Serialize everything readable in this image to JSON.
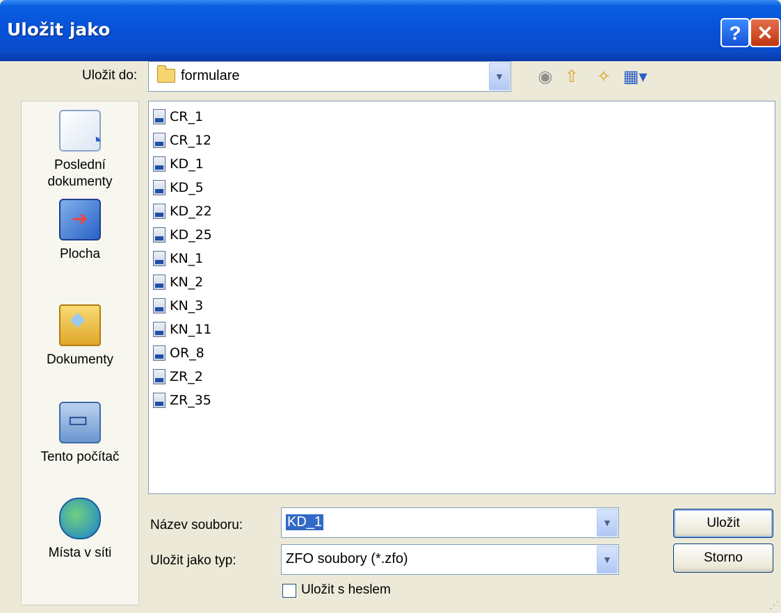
{
  "window": {
    "title": "Uložit jako",
    "help_label": "?",
    "close_label": "✕"
  },
  "toolbar": {
    "lookin_label": "Uložit do:",
    "lookin_value": "formulare",
    "icons": [
      "back-icon",
      "up-folder-icon",
      "new-folder-icon",
      "view-menu-icon"
    ]
  },
  "places": [
    {
      "label": "Poslední dokumenty",
      "icon": "recent-documents-icon"
    },
    {
      "label": "Plocha",
      "icon": "desktop-icon"
    },
    {
      "label": "Dokumenty",
      "icon": "my-documents-icon"
    },
    {
      "label": "Tento počítač",
      "icon": "my-computer-icon"
    },
    {
      "label": "Místa v síti",
      "icon": "network-places-icon"
    }
  ],
  "files": [
    "CR_1",
    "CR_12",
    "KD_1",
    "KD_5",
    "KD_22",
    "KD_25",
    "KN_1",
    "KN_2",
    "KN_3",
    "KN_11",
    "OR_8",
    "ZR_2",
    "ZR_35"
  ],
  "form": {
    "filename_label": "Název souboru:",
    "filename_value": "KD_1",
    "filetype_label": "Uložit jako typ:",
    "filetype_value": "ZFO soubory (*.zfo)",
    "password_label": "Uložit s heslem",
    "password_checked": false
  },
  "buttons": {
    "save": "Uložit",
    "cancel": "Storno"
  },
  "colors": {
    "titlebar": "#0651d8",
    "dialog_bg": "#ece9d8",
    "selection": "#316ac5"
  }
}
